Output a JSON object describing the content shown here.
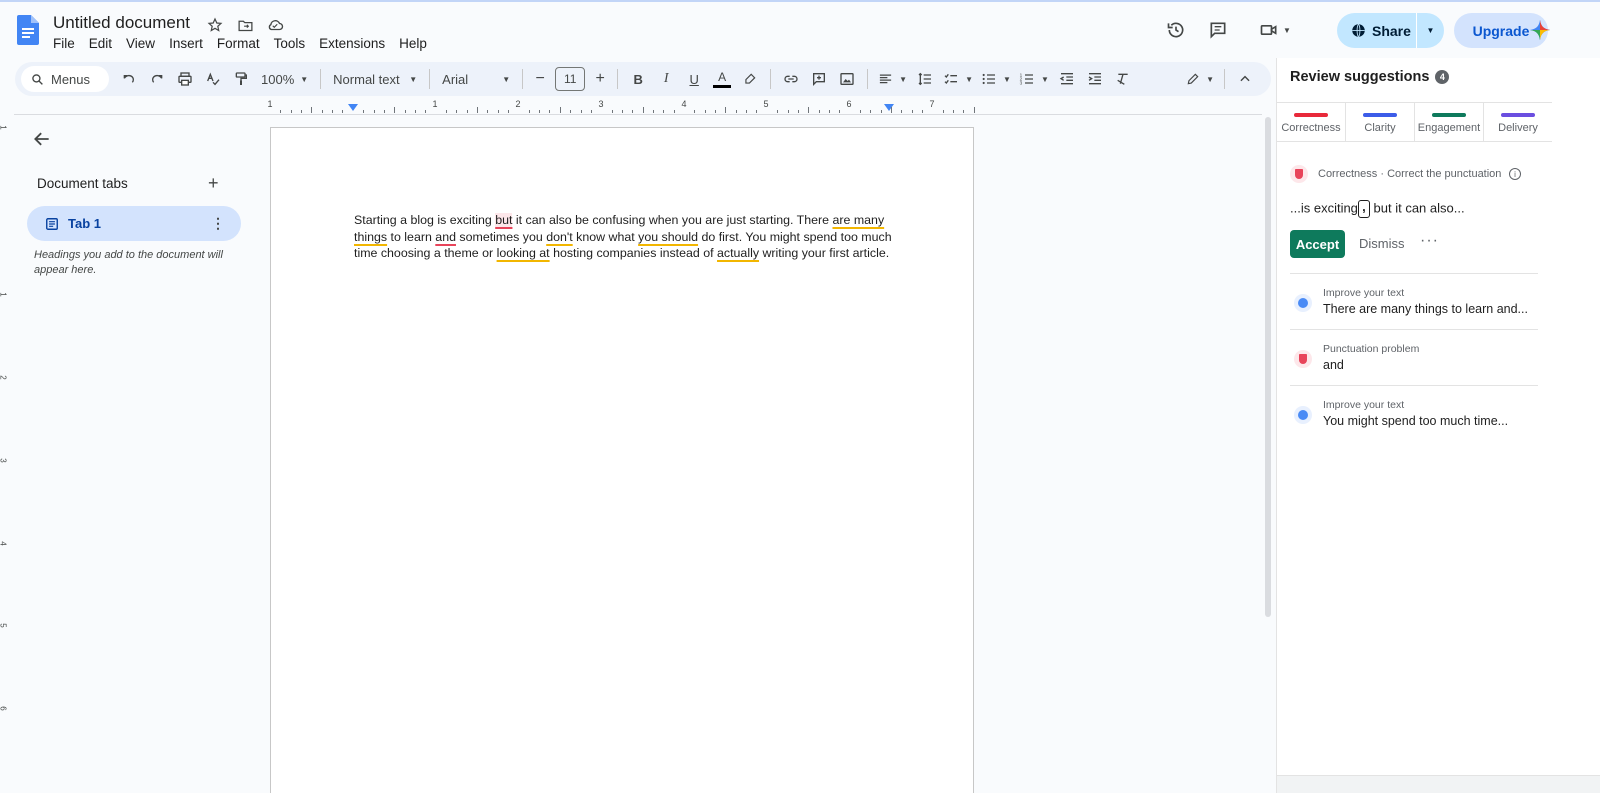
{
  "doc": {
    "title": "Untitled document",
    "menus": [
      "File",
      "Edit",
      "View",
      "Insert",
      "Format",
      "Tools",
      "Extensions",
      "Help"
    ]
  },
  "header": {
    "share_label": "Share",
    "upgrade_label": "Upgrade"
  },
  "toolbar": {
    "search_label": "Menus",
    "zoom": "100%",
    "style": "Normal text",
    "font": "Arial",
    "font_size": "11"
  },
  "ruler": {
    "marks": [
      "1",
      "1",
      "2",
      "3",
      "4",
      "5",
      "6",
      "7"
    ],
    "vmarks": [
      "1",
      "1",
      "2",
      "3",
      "4",
      "5",
      "6"
    ]
  },
  "sidebar": {
    "header": "Document tabs",
    "tab_label": "Tab 1",
    "hint": "Headings you add to the document will appear here."
  },
  "document": {
    "segments": [
      {
        "t": "Starting a blog is exciting ",
        "s": ""
      },
      {
        "t": "but",
        "s": "r"
      },
      {
        "t": " it can also be confusing when you are just starting. There ",
        "s": ""
      },
      {
        "t": "are many things",
        "s": "y"
      },
      {
        "t": " to learn ",
        "s": ""
      },
      {
        "t": "and",
        "s": "p"
      },
      {
        "t": " sometimes you ",
        "s": ""
      },
      {
        "t": "don't",
        "s": "y"
      },
      {
        "t": " know what ",
        "s": ""
      },
      {
        "t": "you should",
        "s": "y"
      },
      {
        "t": " do first. You might spend too much time choosing a theme or ",
        "s": ""
      },
      {
        "t": "looking at",
        "s": "y"
      },
      {
        "t": " hosting companies instead of ",
        "s": ""
      },
      {
        "t": "actually",
        "s": "y"
      },
      {
        "t": " writing your first article.",
        "s": ""
      }
    ]
  },
  "review": {
    "title": "Review suggestions",
    "count": "4",
    "tabs": [
      {
        "label": "Correctness",
        "color": "#e8293a"
      },
      {
        "label": "Clarity",
        "color": "#3c5ce8"
      },
      {
        "label": "Engagement",
        "color": "#0e7a5c"
      },
      {
        "label": "Delivery",
        "color": "#6b4ee0"
      }
    ],
    "active": {
      "heading": "Correctness · Correct the punctuation",
      "preview_before": "...is exciting",
      "preview_mark": ",",
      "preview_after": " but it can also...",
      "accept": "Accept",
      "dismiss": "Dismiss",
      "more": "···"
    },
    "items": [
      {
        "category": "Improve your text",
        "text": "There are many things to learn and...",
        "kind": "blue"
      },
      {
        "category": "Punctuation problem",
        "text": "and",
        "kind": "red"
      },
      {
        "category": "Improve your text",
        "text": "You might spend too much time...",
        "kind": "blue"
      }
    ]
  }
}
